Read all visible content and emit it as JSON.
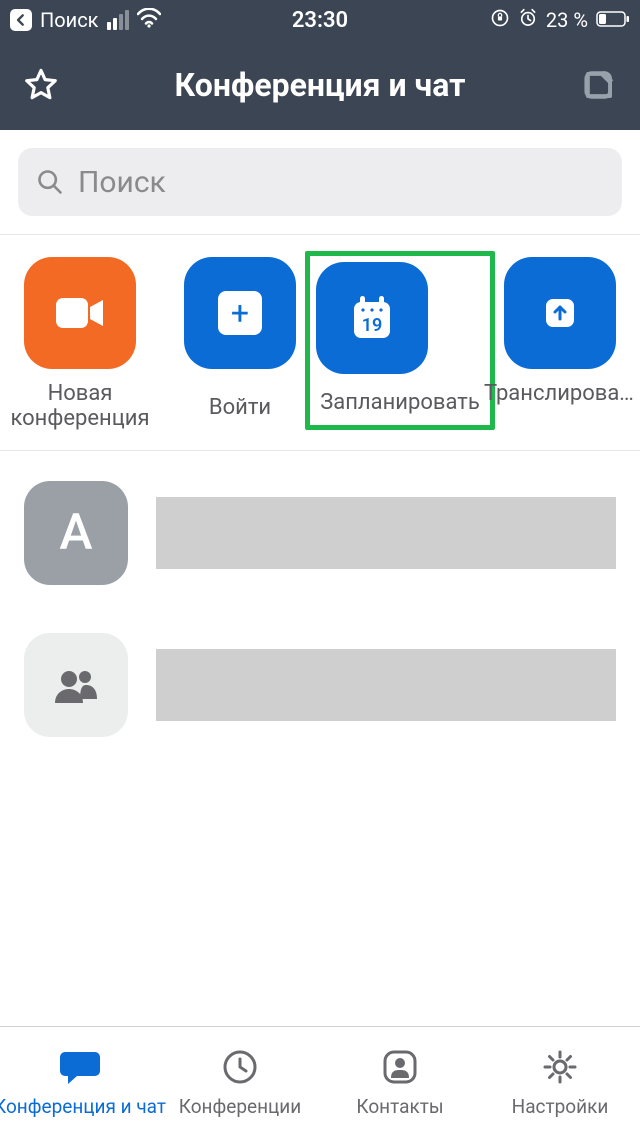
{
  "status_bar": {
    "back_label": "Поиск",
    "time": "23:30",
    "battery_text": "23 %"
  },
  "header": {
    "title": "Конференция и чат"
  },
  "search": {
    "placeholder": "Поиск"
  },
  "actions": {
    "new_meeting": "Новая\nконференция",
    "join": "Войти",
    "schedule": "Запланировать",
    "schedule_day": "19",
    "broadcast": "Транслировать демонстрацию"
  },
  "list": {
    "avatar_letter": "А"
  },
  "tabs": {
    "home": "Конференция и чат",
    "meetings": "Конференции",
    "contacts": "Контакты",
    "settings": "Настройки"
  },
  "colors": {
    "accent_blue": "#0b6cd6",
    "accent_orange": "#f26a24",
    "highlight_green": "#1fb84b"
  }
}
